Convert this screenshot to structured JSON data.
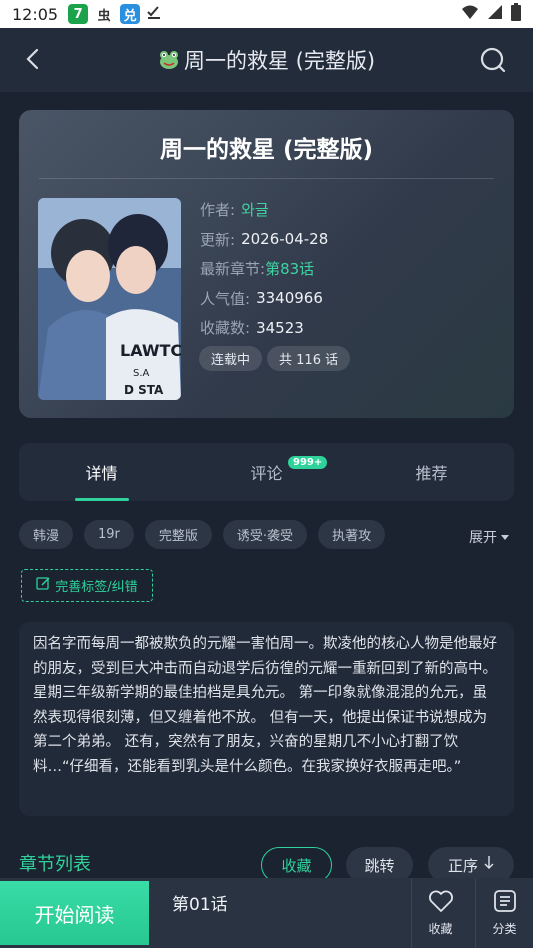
{
  "status_bar": {
    "time": "12:05"
  },
  "topbar": {
    "title": "周一的救星 (完整版)"
  },
  "card": {
    "title": "周一的救星 (完整版)",
    "author_label": "作者:",
    "author": "와글",
    "updated_label": "更新:",
    "updated": "2026-04-28",
    "latest_label": "最新章节:",
    "latest": "第83话",
    "popularity_label": "人气值:",
    "popularity": "3340966",
    "favorites_label": "收藏数:",
    "favorites": "34523",
    "status_badge": "连载中",
    "count_badge": "共 116 话"
  },
  "tabs": [
    {
      "label": "详情"
    },
    {
      "label": "评论",
      "count": "999+"
    },
    {
      "label": "推荐"
    }
  ],
  "tags": [
    "韩漫",
    "19r",
    "完整版",
    "诱受·袭受",
    "执著攻"
  ],
  "expand_label": "展开",
  "fix_tag_label": "完善标签/纠错",
  "description": "因名字而每周一都被欺负的元耀一害怕周一。欺凌他的核心人物是他最好的朋友，受到巨大冲击而自动退学后彷徨的元耀一重新回到了新的高中。 星期三年级新学期的最佳拍档是具允元。 第一印象就像混混的允元，虽然表现得很刻薄，但又缠着他不放。 但有一天，他提出保证书说想成为第二个弟弟。 还有，突然有了朋友，兴奋的星期几不小心打翻了饮料…“仔细看，还能看到乳头是什么颜色。在我家换好衣服再走吧。”",
  "chapters": {
    "header": "章节列表",
    "fav_label": "收藏",
    "jump_label": "跳转",
    "order_label": "正序"
  },
  "bottom": {
    "start_label": "开始阅读",
    "current_chapter": "第01话",
    "fav_label": "收藏",
    "category_label": "分类"
  },
  "colors": {
    "accent": "#2fd29a",
    "background": "#1b2230"
  }
}
